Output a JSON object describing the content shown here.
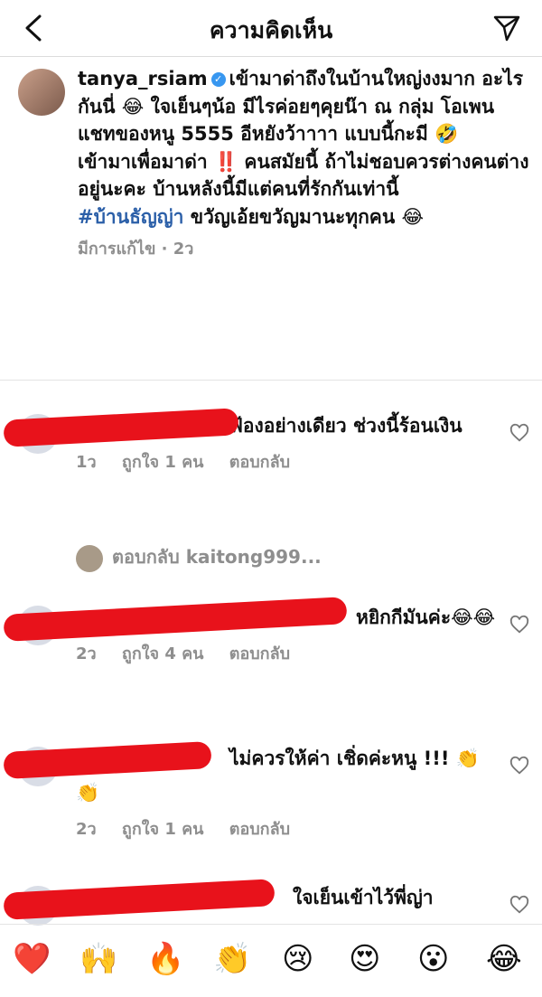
{
  "header": {
    "title": "ความคิดเห็น"
  },
  "caption": {
    "username": "tanya_rsiam",
    "line1": "เข้ามาด่าถึงในบ้านใหญ่งงมาก อะไรกันนี่ 😂 ใจเย็นๆน้อ มีไรค่อยๆคุยน๊า ณ กลุ่ม โอเพนแชทของหนู 5555 อีหยังว้าาาา แบบนี้กะมี 🤣",
    "line2": "เข้ามาเพื่อมาด่า ‼️ คนสมัยนี้ ถ้าไม่ชอบควรต่างคนต่างอยู่นะคะ บ้านหลังนี้มีแต่คนที่รักกันเท่านี้",
    "hashtag": "#บ้านธัญญ่า",
    "line3": " ขวัญเอ้ยขวัญมานะทุกคน 😂",
    "meta": "มีการแก้ไข · 2ว"
  },
  "comments": [
    {
      "text": "ฟ้องอย่างเดียว ช่วงนี้ร้อนเงิน",
      "time": "1ว",
      "likes": "ถูกใจ 1 คน",
      "reply": "ตอบกลับ"
    },
    {
      "text": "หยิกกีมันค่ะ😂😂",
      "time": "2ว",
      "likes": "ถูกใจ 4 คน",
      "reply": "ตอบกลับ"
    },
    {
      "text": "ไม่ควรให้ค่า เชิ่ดค่ะหนู !!! 👏👏",
      "time": "2ว",
      "likes": "ถูกใจ 1 คน",
      "reply": "ตอบกลับ"
    },
    {
      "text": "ใจเย็นเข้าไว้พี่ญ่า"
    }
  ],
  "reply_to": "ตอบกลับ kaitong999...",
  "emoji_bar": [
    "❤️",
    "🙌",
    "🔥",
    "👏",
    "😢",
    "😍",
    "😮",
    "😂"
  ]
}
